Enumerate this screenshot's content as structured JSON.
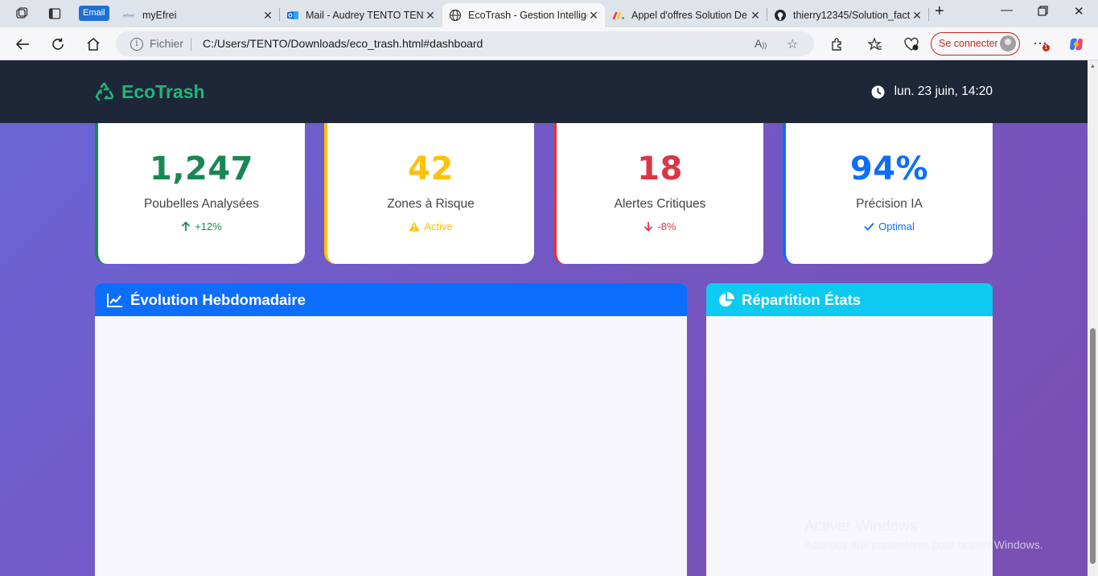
{
  "browser": {
    "email_badge": "Email",
    "tabs": [
      {
        "title": "myEfrei",
        "favicon": "efrei-icon"
      },
      {
        "title": "Mail - Audrey TENTO TENTO",
        "favicon": "outlook-icon"
      },
      {
        "title": "EcoTrash - Gestion Intelligente",
        "favicon": "globe-icon",
        "active": true
      },
      {
        "title": "Appel d'offres Solution De",
        "favicon": "monday-icon"
      },
      {
        "title": "thierry12345/Solution_fact",
        "favicon": "github-icon"
      }
    ],
    "address": {
      "scheme_label": "Fichier",
      "url": "C:/Users/TENTO/Downloads/eco_trash.html#dashboard"
    },
    "sign_in_label": "Se connecter",
    "notification_count": "1"
  },
  "app": {
    "brand": "EcoTrash",
    "datetime": "lun. 23 juin, 14:20"
  },
  "stats": [
    {
      "value": "1,247",
      "label": "Poubelles Analysées",
      "trend": "+12%",
      "trend_icon": "arrow-up-icon",
      "color": "#198754"
    },
    {
      "value": "42",
      "label": "Zones à Risque",
      "trend": "Active",
      "trend_icon": "warning-icon",
      "color": "#ffc107"
    },
    {
      "value": "18",
      "label": "Alertes Critiques",
      "trend": "-8%",
      "trend_icon": "arrow-down-icon",
      "color": "#dc3545"
    },
    {
      "value": "94%",
      "label": "Précision IA",
      "trend": "Optimal",
      "trend_icon": "check-icon",
      "color": "#0d6efd"
    }
  ],
  "panels": {
    "weekly": {
      "title": "Évolution Hebdomadaire",
      "color": "#0d6efd"
    },
    "states": {
      "title": "Répartition États",
      "color": "#0dcaf0"
    }
  },
  "watermark": {
    "line1": "Activer Windows",
    "line2": "Accédez aux paramètres pour activer Windows."
  }
}
